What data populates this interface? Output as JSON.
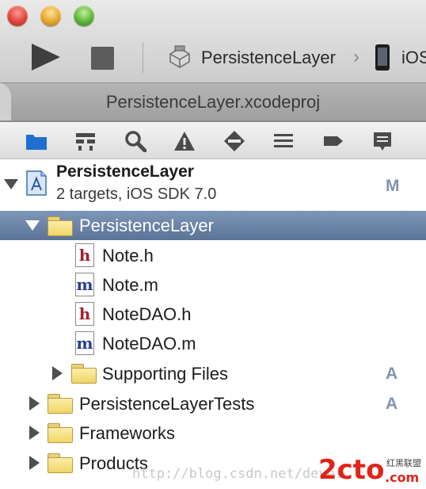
{
  "window": {
    "scheme": "PersistenceLayer",
    "device": "iOS",
    "tab_title": "PersistenceLayer.xcodeproj"
  },
  "navigator": {
    "icons": [
      "project-navigator-icon",
      "symbol-navigator-icon",
      "search-navigator-icon",
      "issue-navigator-icon",
      "test-navigator-icon",
      "debug-navigator-icon",
      "breakpoint-navigator-icon",
      "log-navigator-icon"
    ]
  },
  "project": {
    "name": "PersistenceLayer",
    "subtitle": "2 targets, iOS SDK 7.0",
    "badge": "M"
  },
  "tree": [
    {
      "label": "PersistenceLayer",
      "kind": "group",
      "expanded": true,
      "selected": true
    },
    {
      "label": "Note.h",
      "kind": "file-h"
    },
    {
      "label": "Note.m",
      "kind": "file-m"
    },
    {
      "label": "NoteDAO.h",
      "kind": "file-h"
    },
    {
      "label": "NoteDAO.m",
      "kind": "file-m"
    },
    {
      "label": "Supporting Files",
      "kind": "group",
      "badge": "A"
    },
    {
      "label": "PersistenceLayerTests",
      "kind": "group",
      "badge": "A"
    },
    {
      "label": "Frameworks",
      "kind": "group"
    },
    {
      "label": "Products",
      "kind": "group"
    }
  ],
  "watermark": {
    "url_text": "http://blog.csdn.net/devel",
    "logo_text": "2cto",
    "logo_domain": ".com",
    "logo_cn": "红黑联盟"
  },
  "colors": {
    "selection": "#6b83a6",
    "badge": "#7f93b0",
    "watermark_logo": "#e2231a"
  }
}
